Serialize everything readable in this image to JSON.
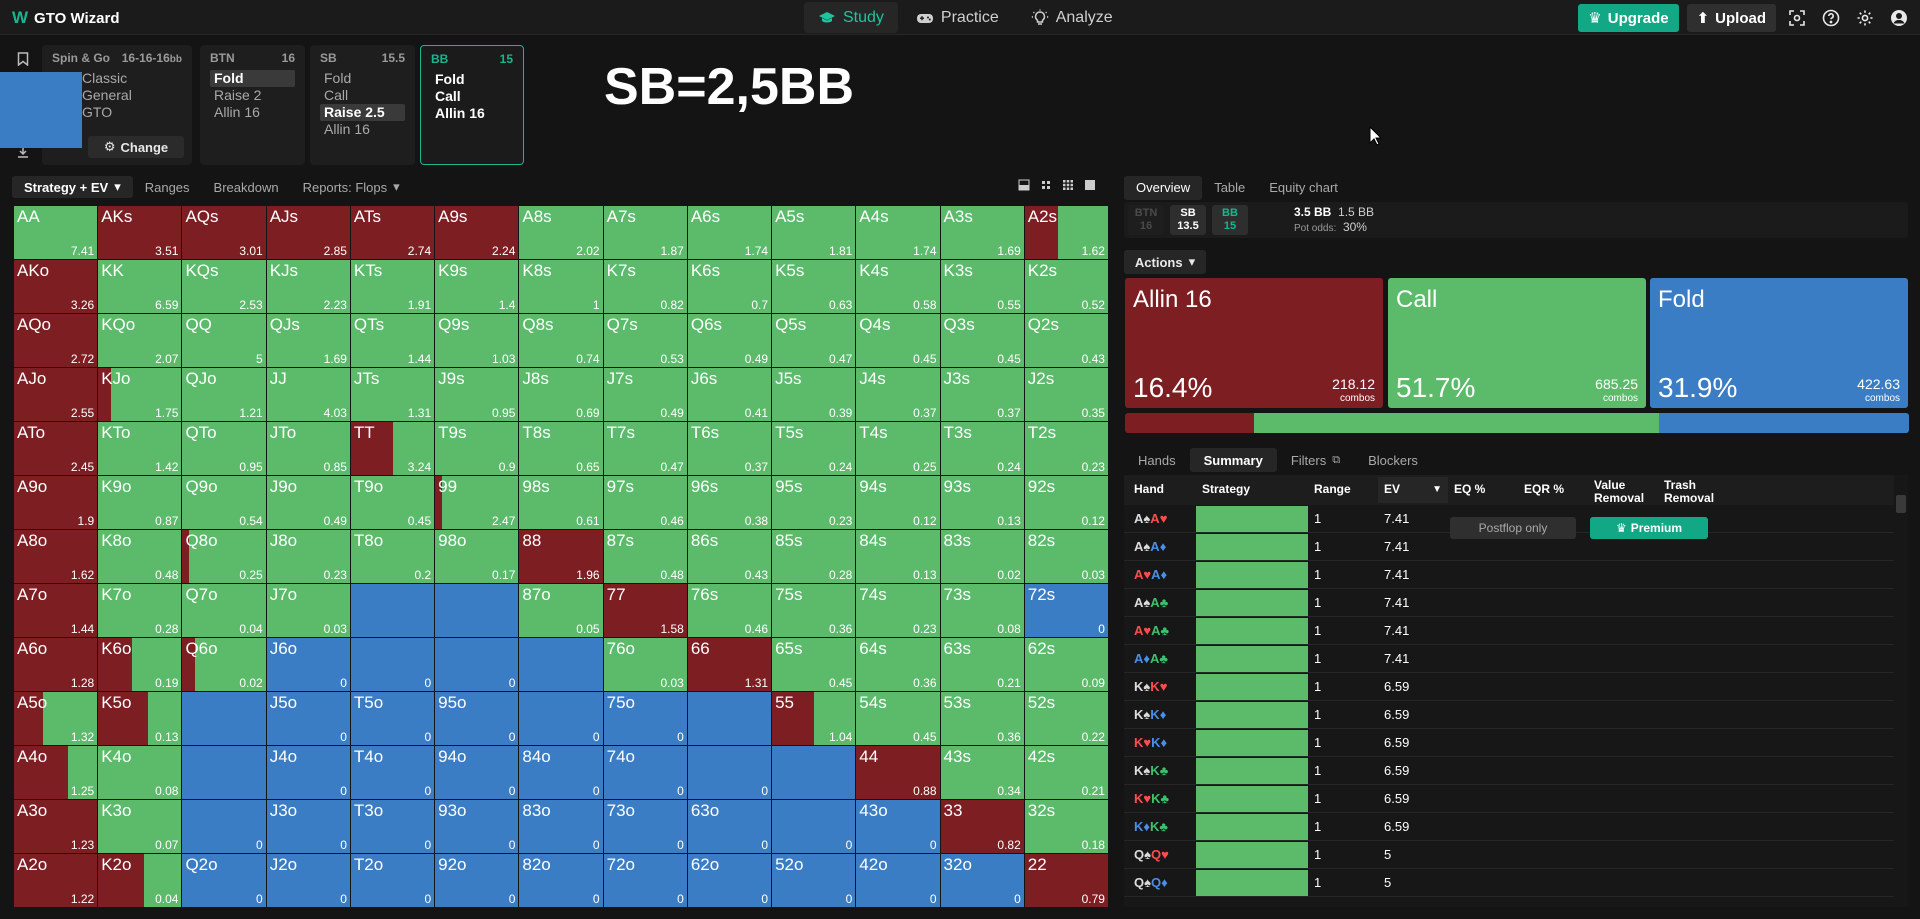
{
  "app": {
    "title": "GTO Wizard"
  },
  "nav": [
    {
      "label": "Study",
      "icon": "graduation-cap-icon",
      "active": true
    },
    {
      "label": "Practice",
      "icon": "gamepad-icon",
      "active": false
    },
    {
      "label": "Analyze",
      "icon": "lightbulb-icon",
      "active": false
    }
  ],
  "topright": {
    "upgrade": "Upgrade",
    "upload": "Upload"
  },
  "format": {
    "name": "Spin & Go",
    "stacks": "16-16-16",
    "unit": "bb",
    "lines": [
      "Classic",
      "General",
      "GTO"
    ],
    "change": "Change"
  },
  "positions": [
    {
      "pos": "BTN",
      "stack": "16",
      "actions": [
        "Fold",
        "Raise 2",
        "Allin 16"
      ],
      "selected": 0
    },
    {
      "pos": "SB",
      "stack": "15.5",
      "actions": [
        "Fold",
        "Call",
        "Raise 2.5",
        "Allin 16"
      ],
      "selected": 2
    },
    {
      "pos": "BB",
      "stack": "15",
      "actions": [
        "Fold",
        "Call",
        "Allin 16"
      ],
      "selected": -1
    }
  ],
  "overlay_title": "SB=2,5BB",
  "left_tabs": [
    "Strategy + EV",
    "Ranges",
    "Breakdown",
    "Reports: Flops"
  ],
  "right_tabs": [
    "Overview",
    "Table",
    "Equity chart"
  ],
  "seats": [
    {
      "pos": "BTN",
      "stack": "16"
    },
    {
      "pos": "SB",
      "stack": "13.5"
    },
    {
      "pos": "BB",
      "stack": "15"
    }
  ],
  "pot": {
    "total": "3.5 BB",
    "call": "1.5 BB",
    "odds_label": "Pot odds:",
    "odds": "30%"
  },
  "actions_dropdown": "Actions",
  "actions": [
    {
      "name": "Allin 16",
      "pct": "16.4%",
      "combos": "218.12",
      "combos_label": "combos",
      "color": "#7d1e23",
      "share": 16.4
    },
    {
      "name": "Call",
      "pct": "51.7%",
      "combos": "685.25",
      "combos_label": "combos",
      "color": "#5bbb6b",
      "share": 51.7
    },
    {
      "name": "Fold",
      "pct": "31.9%",
      "combos": "422.63",
      "combos_label": "combos",
      "color": "#3b7dc4",
      "share": 31.9
    }
  ],
  "bottom_tabs": [
    "Hands",
    "Summary",
    "Filters",
    "Blockers"
  ],
  "table_headers": {
    "hand": "Hand",
    "strategy": "Strategy",
    "range": "Range",
    "ev": "EV",
    "eq": "EQ %",
    "eqr": "EQR %",
    "value": "Value Removal",
    "trash": "Trash Removal"
  },
  "postflop_only": "Postflop only",
  "premium": "Premium",
  "hand_rows": [
    {
      "c1": "A",
      "s1": "sp",
      "c2": "A",
      "s2": "ht",
      "range": "1",
      "ev": "7.41"
    },
    {
      "c1": "A",
      "s1": "sp",
      "c2": "A",
      "s2": "di",
      "range": "1",
      "ev": "7.41"
    },
    {
      "c1": "A",
      "s1": "ht",
      "c2": "A",
      "s2": "di",
      "range": "1",
      "ev": "7.41"
    },
    {
      "c1": "A",
      "s1": "sp",
      "c2": "A",
      "s2": "cl",
      "range": "1",
      "ev": "7.41"
    },
    {
      "c1": "A",
      "s1": "ht",
      "c2": "A",
      "s2": "cl",
      "range": "1",
      "ev": "7.41"
    },
    {
      "c1": "A",
      "s1": "di",
      "c2": "A",
      "s2": "cl",
      "range": "1",
      "ev": "7.41"
    },
    {
      "c1": "K",
      "s1": "sp",
      "c2": "K",
      "s2": "ht",
      "range": "1",
      "ev": "6.59"
    },
    {
      "c1": "K",
      "s1": "sp",
      "c2": "K",
      "s2": "di",
      "range": "1",
      "ev": "6.59"
    },
    {
      "c1": "K",
      "s1": "ht",
      "c2": "K",
      "s2": "di",
      "range": "1",
      "ev": "6.59"
    },
    {
      "c1": "K",
      "s1": "sp",
      "c2": "K",
      "s2": "cl",
      "range": "1",
      "ev": "6.59"
    },
    {
      "c1": "K",
      "s1": "ht",
      "c2": "K",
      "s2": "cl",
      "range": "1",
      "ev": "6.59"
    },
    {
      "c1": "K",
      "s1": "di",
      "c2": "K",
      "s2": "cl",
      "range": "1",
      "ev": "6.59"
    },
    {
      "c1": "Q",
      "s1": "sp",
      "c2": "Q",
      "s2": "ht",
      "range": "1",
      "ev": "5"
    },
    {
      "c1": "Q",
      "s1": "sp",
      "c2": "Q",
      "s2": "di",
      "range": "1",
      "ev": "5"
    }
  ],
  "matrix": [
    [
      [
        "AA",
        "7.41",
        "g"
      ],
      [
        "AKs",
        "3.51",
        "r"
      ],
      [
        "AQs",
        "3.01",
        "r"
      ],
      [
        "AJs",
        "2.85",
        "r"
      ],
      [
        "ATs",
        "2.74",
        "r"
      ],
      [
        "A9s",
        "2.24",
        "r"
      ],
      [
        "A8s",
        "2.02",
        "g"
      ],
      [
        "A7s",
        "1.87",
        "g"
      ],
      [
        "A6s",
        "1.74",
        "g"
      ],
      [
        "A5s",
        "1.81",
        "g"
      ],
      [
        "A4s",
        "1.74",
        "g"
      ],
      [
        "A3s",
        "1.69",
        "g"
      ],
      [
        "A2s",
        "1.62",
        "mr40"
      ]
    ],
    [
      [
        "AKo",
        "3.26",
        "r"
      ],
      [
        "KK",
        "6.59",
        "g"
      ],
      [
        "KQs",
        "2.53",
        "g"
      ],
      [
        "KJs",
        "2.23",
        "g"
      ],
      [
        "KTs",
        "1.91",
        "g"
      ],
      [
        "K9s",
        "1.4",
        "g"
      ],
      [
        "K8s",
        "1",
        "g"
      ],
      [
        "K7s",
        "0.82",
        "g"
      ],
      [
        "K6s",
        "0.7",
        "g"
      ],
      [
        "K5s",
        "0.63",
        "g"
      ],
      [
        "K4s",
        "0.58",
        "g"
      ],
      [
        "K3s",
        "0.55",
        "g"
      ],
      [
        "K2s",
        "0.52",
        "g"
      ]
    ],
    [
      [
        "AQo",
        "2.72",
        "r"
      ],
      [
        "KQo",
        "2.07",
        "g"
      ],
      [
        "QQ",
        "5",
        "g"
      ],
      [
        "QJs",
        "1.69",
        "g"
      ],
      [
        "QTs",
        "1.44",
        "g"
      ],
      [
        "Q9s",
        "1.03",
        "g"
      ],
      [
        "Q8s",
        "0.74",
        "g"
      ],
      [
        "Q7s",
        "0.53",
        "g"
      ],
      [
        "Q6s",
        "0.49",
        "g"
      ],
      [
        "Q5s",
        "0.47",
        "g"
      ],
      [
        "Q4s",
        "0.45",
        "g"
      ],
      [
        "Q3s",
        "0.45",
        "g"
      ],
      [
        "Q2s",
        "0.43",
        "g"
      ]
    ],
    [
      [
        "AJo",
        "2.55",
        "r"
      ],
      [
        "KJo",
        "1.75",
        "mr15"
      ],
      [
        "QJo",
        "1.21",
        "g"
      ],
      [
        "JJ",
        "4.03",
        "g"
      ],
      [
        "JTs",
        "1.31",
        "g"
      ],
      [
        "J9s",
        "0.95",
        "g"
      ],
      [
        "J8s",
        "0.69",
        "g"
      ],
      [
        "J7s",
        "0.49",
        "g"
      ],
      [
        "J6s",
        "0.41",
        "g"
      ],
      [
        "J5s",
        "0.39",
        "g"
      ],
      [
        "J4s",
        "0.37",
        "g"
      ],
      [
        "J3s",
        "0.37",
        "g"
      ],
      [
        "J2s",
        "0.35",
        "g"
      ]
    ],
    [
      [
        "ATo",
        "2.45",
        "r"
      ],
      [
        "KTo",
        "1.42",
        "g"
      ],
      [
        "QTo",
        "0.95",
        "g"
      ],
      [
        "JTo",
        "0.85",
        "g"
      ],
      [
        "TT",
        "3.24",
        "mr50"
      ],
      [
        "T9s",
        "0.9",
        "g"
      ],
      [
        "T8s",
        "0.65",
        "g"
      ],
      [
        "T7s",
        "0.47",
        "g"
      ],
      [
        "T6s",
        "0.37",
        "g"
      ],
      [
        "T5s",
        "0.24",
        "g"
      ],
      [
        "T4s",
        "0.25",
        "g"
      ],
      [
        "T3s",
        "0.24",
        "g"
      ],
      [
        "T2s",
        "0.23",
        "g"
      ]
    ],
    [
      [
        "A9o",
        "1.9",
        "r"
      ],
      [
        "K9o",
        "0.87",
        "g"
      ],
      [
        "Q9o",
        "0.54",
        "g"
      ],
      [
        "J9o",
        "0.49",
        "g"
      ],
      [
        "T9o",
        "0.45",
        "g"
      ],
      [
        "99",
        "2.47",
        "mr8"
      ],
      [
        "98s",
        "0.61",
        "g"
      ],
      [
        "97s",
        "0.46",
        "g"
      ],
      [
        "96s",
        "0.38",
        "g"
      ],
      [
        "95s",
        "0.23",
        "g"
      ],
      [
        "94s",
        "0.12",
        "g"
      ],
      [
        "93s",
        "0.13",
        "g"
      ],
      [
        "92s",
        "0.12",
        "g"
      ]
    ],
    [
      [
        "A8o",
        "1.62",
        "r"
      ],
      [
        "K8o",
        "0.48",
        "g"
      ],
      [
        "Q8o",
        "0.25",
        "mr8"
      ],
      [
        "J8o",
        "0.23",
        "g"
      ],
      [
        "T8o",
        "0.2",
        "g"
      ],
      [
        "98o",
        "0.17",
        "g"
      ],
      [
        "88",
        "1.96",
        "r"
      ],
      [
        "87s",
        "0.48",
        "g"
      ],
      [
        "86s",
        "0.43",
        "g"
      ],
      [
        "85s",
        "0.28",
        "g"
      ],
      [
        "84s",
        "0.13",
        "g"
      ],
      [
        "83s",
        "0.02",
        "g"
      ],
      [
        "82s",
        "0.03",
        "g"
      ]
    ],
    [
      [
        "A7o",
        "1.44",
        "r"
      ],
      [
        "K7o",
        "0.28",
        "g"
      ],
      [
        "Q7o",
        "0.04",
        "g"
      ],
      [
        "J7o",
        "0.03",
        "g"
      ],
      [
        "",
        "",
        "b"
      ],
      [
        "",
        "",
        "b"
      ],
      [
        "87o",
        "0.05",
        "g"
      ],
      [
        "77",
        "1.58",
        "r"
      ],
      [
        "76s",
        "0.46",
        "g"
      ],
      [
        "75s",
        "0.36",
        "g"
      ],
      [
        "74s",
        "0.23",
        "g"
      ],
      [
        "73s",
        "0.08",
        "g"
      ],
      [
        "72s",
        "0",
        "b"
      ]
    ],
    [
      [
        "A6o",
        "1.28",
        "r"
      ],
      [
        "K6o",
        "0.19",
        "mr40"
      ],
      [
        "Q6o",
        "0.02",
        "mr15"
      ],
      [
        "J6o",
        "0",
        "b"
      ],
      [
        "",
        "0",
        "b"
      ],
      [
        "",
        "0",
        "b"
      ],
      [
        "",
        "",
        "b"
      ],
      [
        "76o",
        "0.03",
        "g"
      ],
      [
        "66",
        "1.31",
        "r"
      ],
      [
        "65s",
        "0.45",
        "g"
      ],
      [
        "64s",
        "0.36",
        "g"
      ],
      [
        "63s",
        "0.21",
        "g"
      ],
      [
        "62s",
        "0.09",
        "g"
      ]
    ],
    [
      [
        "A5o",
        "1.32",
        "mr35"
      ],
      [
        "K5o",
        "0.13",
        "mr60"
      ],
      [
        "",
        "",
        "b"
      ],
      [
        "J5o",
        "0",
        "b"
      ],
      [
        "T5o",
        "0",
        "b"
      ],
      [
        "95o",
        "0",
        "b"
      ],
      [
        "",
        "0",
        "b"
      ],
      [
        "75o",
        "0",
        "b"
      ],
      [
        "",
        "",
        "b"
      ],
      [
        "55",
        "1.04",
        "mr50"
      ],
      [
        "54s",
        "0.45",
        "g"
      ],
      [
        "53s",
        "0.36",
        "g"
      ],
      [
        "52s",
        "0.22",
        "g"
      ]
    ],
    [
      [
        "A4o",
        "1.25",
        "mr65"
      ],
      [
        "K4o",
        "0.08",
        "g"
      ],
      [
        "",
        "",
        "b"
      ],
      [
        "J4o",
        "0",
        "b"
      ],
      [
        "T4o",
        "0",
        "b"
      ],
      [
        "94o",
        "0",
        "b"
      ],
      [
        "84o",
        "0",
        "b"
      ],
      [
        "74o",
        "0",
        "b"
      ],
      [
        "",
        "0",
        "b"
      ],
      [
        "",
        "",
        "b"
      ],
      [
        "44",
        "0.88",
        "r"
      ],
      [
        "43s",
        "0.34",
        "g"
      ],
      [
        "42s",
        "0.21",
        "g"
      ]
    ],
    [
      [
        "A3o",
        "1.23",
        "r"
      ],
      [
        "K3o",
        "0.07",
        "g"
      ],
      [
        "",
        "0",
        "b"
      ],
      [
        "J3o",
        "0",
        "b"
      ],
      [
        "T3o",
        "0",
        "b"
      ],
      [
        "93o",
        "0",
        "b"
      ],
      [
        "83o",
        "0",
        "b"
      ],
      [
        "73o",
        "0",
        "b"
      ],
      [
        "63o",
        "0",
        "b"
      ],
      [
        "",
        "0",
        "b"
      ],
      [
        "43o",
        "0",
        "b"
      ],
      [
        "33",
        "0.82",
        "r"
      ],
      [
        "32s",
        "0.18",
        "g"
      ]
    ],
    [
      [
        "A2o",
        "1.22",
        "r"
      ],
      [
        "K2o",
        "0.04",
        "mr55"
      ],
      [
        "Q2o",
        "0",
        "b"
      ],
      [
        "J2o",
        "0",
        "b"
      ],
      [
        "T2o",
        "0",
        "b"
      ],
      [
        "92o",
        "0",
        "b"
      ],
      [
        "82o",
        "0",
        "b"
      ],
      [
        "72o",
        "0",
        "b"
      ],
      [
        "62o",
        "0",
        "b"
      ],
      [
        "52o",
        "0",
        "b"
      ],
      [
        "42o",
        "0",
        "b"
      ],
      [
        "32o",
        "0",
        "b"
      ],
      [
        "22",
        "0.79",
        "r"
      ]
    ]
  ],
  "colors": {
    "raise": "#7d1e23",
    "call": "#5bbb6b",
    "fold": "#3b7dc4",
    "accent": "#18b58e"
  }
}
